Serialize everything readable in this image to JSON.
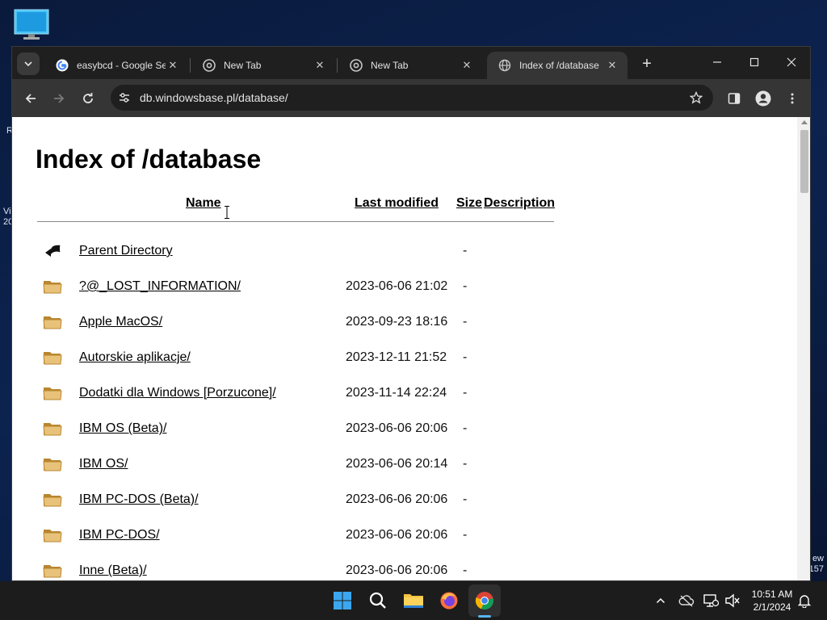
{
  "desktop": {
    "edge_left_1": "R",
    "edge_left_2": "Vi",
    "edge_left_3": "20",
    "edge_right_1": "ew",
    "edge_right_2": "157"
  },
  "browser": {
    "tabs": [
      {
        "title": "easybcd - Google Se",
        "favicon": "google-icon"
      },
      {
        "title": "New Tab",
        "favicon": "chrome-icon"
      },
      {
        "title": "New Tab",
        "favicon": "chrome-icon"
      },
      {
        "title": "Index of /database",
        "favicon": "globe-icon",
        "active": true
      }
    ],
    "new_tab_label": "+",
    "close_glyph": "✕",
    "url": "db.windowsbase.pl/database/"
  },
  "page": {
    "title": "Index of /database",
    "columns": {
      "name": "Name",
      "last_modified": "Last modified",
      "size": "Size",
      "description": "Description"
    },
    "rows": [
      {
        "icon": "back-arrow-icon",
        "name": "Parent Directory",
        "date": "",
        "size": "-"
      },
      {
        "icon": "folder-icon",
        "name": "?@_LOST_INFORMATION/",
        "date": "2023-06-06 21:02",
        "size": "-"
      },
      {
        "icon": "folder-icon",
        "name": "Apple MacOS/",
        "date": "2023-09-23 18:16",
        "size": "-"
      },
      {
        "icon": "folder-icon",
        "name": "Autorskie aplikacje/",
        "date": "2023-12-11 21:52",
        "size": "-"
      },
      {
        "icon": "folder-icon",
        "name": "Dodatki dla Windows [Porzucone]/",
        "date": "2023-11-14 22:24",
        "size": "-"
      },
      {
        "icon": "folder-icon",
        "name": "IBM OS (Beta)/",
        "date": "2023-06-06 20:06",
        "size": "-"
      },
      {
        "icon": "folder-icon",
        "name": "IBM OS/",
        "date": "2023-06-06 20:14",
        "size": "-"
      },
      {
        "icon": "folder-icon",
        "name": "IBM PC-DOS (Beta)/",
        "date": "2023-06-06 20:06",
        "size": "-"
      },
      {
        "icon": "folder-icon",
        "name": "IBM PC-DOS/",
        "date": "2023-06-06 20:06",
        "size": "-"
      },
      {
        "icon": "folder-icon",
        "name": "Inne (Beta)/",
        "date": "2023-06-06 20:06",
        "size": "-"
      }
    ]
  },
  "taskbar": {
    "apps": [
      "start-icon",
      "search-icon",
      "file-explorer-icon",
      "firefox-icon",
      "chrome-icon"
    ],
    "time": "10:51 AM",
    "date": "2/1/2024"
  },
  "colors": {
    "folder": "#e8c27a",
    "folder_dark": "#b8862f",
    "chrome_dark": "#1f1f1f",
    "toolbar": "#353535",
    "accent": "#5ab4f0"
  }
}
